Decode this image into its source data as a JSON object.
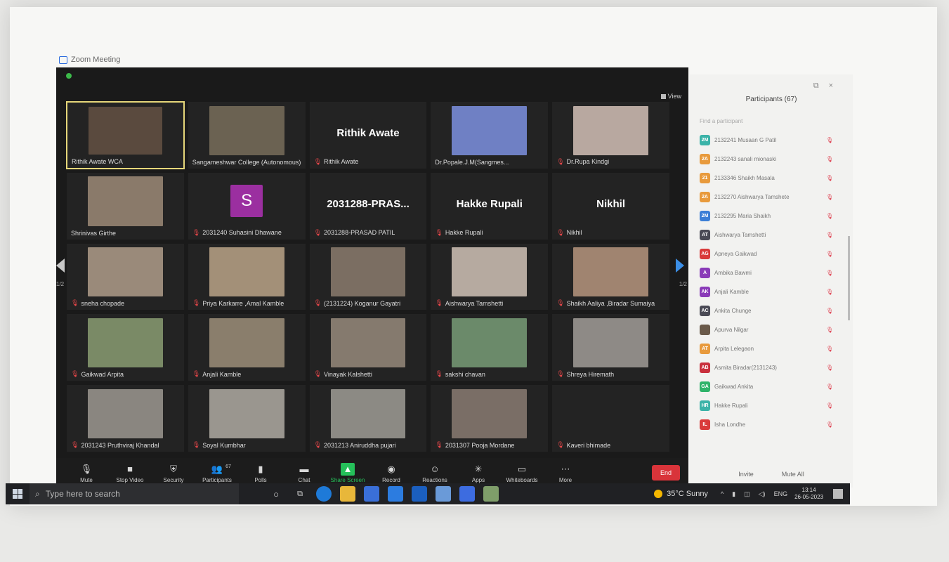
{
  "window": {
    "title": "Zoom Meeting"
  },
  "view_label": "View",
  "grid": [
    {
      "name": "Rithik Awate WCA",
      "kind": "video",
      "bg": "#5a4a3e",
      "active": true,
      "muted": false
    },
    {
      "name": "Sangameshwar College (Autonomous)",
      "kind": "video",
      "bg": "#6b6252",
      "muted": false
    },
    {
      "name": "Rithik Awate",
      "kind": "name",
      "big": "Rithik Awate",
      "muted": true
    },
    {
      "name": "Dr.Popale.J.M(Sangmes...",
      "kind": "video",
      "bg": "#6f80c4",
      "muted": false
    },
    {
      "name": "Dr.Rupa Kindgi",
      "kind": "video",
      "bg": "#b8a8a0",
      "muted": true
    },
    {
      "name": "Shrinivas Girthe",
      "kind": "video",
      "bg": "#8a7a6a",
      "muted": false
    },
    {
      "name": "2031240 Suhasini Dhawane",
      "kind": "avatar",
      "letter": "S",
      "muted": true
    },
    {
      "name": "2031288-PRASAD PATIL",
      "kind": "name",
      "big": "2031288-PRAS...",
      "muted": true
    },
    {
      "name": "Hakke Rupali",
      "kind": "name",
      "big": "Hakke Rupali",
      "muted": true
    },
    {
      "name": "Nikhil",
      "kind": "name",
      "big": "Nikhil",
      "muted": true
    },
    {
      "name": "sneha chopade",
      "kind": "video",
      "bg": "#9a8a7a",
      "muted": true
    },
    {
      "name": "Priya Karkarre ,Amal Kamble",
      "kind": "video",
      "bg": "#a39078",
      "muted": true
    },
    {
      "name": "(2131224) Koganur Gayatri",
      "kind": "video",
      "bg": "#7b6e62",
      "muted": true
    },
    {
      "name": "Aishwarya Tamshetti",
      "kind": "video",
      "bg": "#b6aaa0",
      "muted": true
    },
    {
      "name": "Shaikh Aaliya ,Biradar Sumaiya",
      "kind": "video",
      "bg": "#a08470",
      "muted": true
    },
    {
      "name": "Gaikwad Arpita",
      "kind": "video",
      "bg": "#7a8a66",
      "muted": true
    },
    {
      "name": "Anjali Kamble",
      "kind": "video",
      "bg": "#8a7e6c",
      "muted": true
    },
    {
      "name": "Vinayak Kalshetti",
      "kind": "video",
      "bg": "#857a6e",
      "muted": true
    },
    {
      "name": "sakshi chavan",
      "kind": "video",
      "bg": "#6b8a6a",
      "muted": true
    },
    {
      "name": "Shreya Hiremath",
      "kind": "video",
      "bg": "#8e8a86",
      "muted": true
    },
    {
      "name": "2031243 Pruthviraj Khandal",
      "kind": "video",
      "bg": "#8a8680",
      "muted": true
    },
    {
      "name": "Soyal Kumbhar",
      "kind": "video",
      "bg": "#9a968f",
      "muted": true
    },
    {
      "name": "2031213 Aniruddha pujari",
      "kind": "video",
      "bg": "#8c8a84",
      "muted": true
    },
    {
      "name": "2031307 Pooja Mordane",
      "kind": "video",
      "bg": "#7a6e66",
      "muted": true
    },
    {
      "name": "Kaveri bhimade",
      "kind": "empty",
      "muted": true
    }
  ],
  "pager": {
    "left": "1/2",
    "right": "1/2"
  },
  "toolbar": {
    "items": [
      {
        "label": "Mute",
        "icon": "microphone-icon",
        "glyph": "🎙"
      },
      {
        "label": "Stop Video",
        "icon": "video-camera-icon",
        "glyph": "■"
      },
      {
        "label": "Security",
        "icon": "shield-icon",
        "glyph": "⛨"
      },
      {
        "label": "Participants",
        "icon": "participants-icon",
        "glyph": "👥",
        "badge": "67"
      },
      {
        "label": "Polls",
        "icon": "polls-icon",
        "glyph": "▮"
      },
      {
        "label": "Chat",
        "icon": "chat-icon",
        "glyph": "▬"
      },
      {
        "label": "Share Screen",
        "icon": "share-screen-icon",
        "glyph": "▲"
      },
      {
        "label": "Record",
        "icon": "record-icon",
        "glyph": "◉"
      },
      {
        "label": "Reactions",
        "icon": "reactions-icon",
        "glyph": "☺"
      },
      {
        "label": "Apps",
        "icon": "apps-icon",
        "glyph": "✳"
      },
      {
        "label": "Whiteboards",
        "icon": "whiteboard-icon",
        "glyph": "▭"
      },
      {
        "label": "More",
        "icon": "more-icon",
        "glyph": "⋯"
      }
    ],
    "end_label": "End"
  },
  "participants": {
    "title": "Participants (67)",
    "find_placeholder": "Find a participant",
    "list": [
      {
        "initials": "2M",
        "name": "2132241 Musaan G Patil",
        "color": "#3bb3a8"
      },
      {
        "initials": "2A",
        "name": "2132243 sanali mionaski",
        "color": "#e89a3c"
      },
      {
        "initials": "21",
        "name": "2133346 Shaikh Masala",
        "color": "#e89a3c"
      },
      {
        "initials": "2A",
        "name": "2132270 Aishwarya Tamshete",
        "color": "#e89a3c"
      },
      {
        "initials": "2M",
        "name": "2132295 Maria Shaikh",
        "color": "#3b7ed6"
      },
      {
        "initials": "AT",
        "name": "Aishwarya Tamshetti",
        "color": "#4a4a55"
      },
      {
        "initials": "AG",
        "name": "Apneya Gaikwad",
        "color": "#d93b3b"
      },
      {
        "initials": "A",
        "name": "Ambika Bawmi",
        "color": "#8a3bb8"
      },
      {
        "initials": "AK",
        "name": "Anjali Kamble",
        "color": "#8a3bb8"
      },
      {
        "initials": "AC",
        "name": "Ankita Chunge",
        "color": "#4a4a55"
      },
      {
        "initials": "",
        "name": "Apurva Nilgar",
        "color": "#6a5a4a"
      },
      {
        "initials": "AT",
        "name": "Arpita Lelegaon",
        "color": "#e89a3c"
      },
      {
        "initials": "AB",
        "name": "Asmita Biradar(2131243)",
        "color": "#c9303d"
      },
      {
        "initials": "GA",
        "name": "Gaikwad Ankita",
        "color": "#2fb36a"
      },
      {
        "initials": "HR",
        "name": "Hakke Rupali",
        "color": "#3bb3a8"
      },
      {
        "initials": "IL",
        "name": "Isha Londhe",
        "color": "#d93b3b"
      }
    ],
    "invite_label": "Invite",
    "mute_all_label": "Mute All"
  },
  "taskbar": {
    "search_placeholder": "Type here to search",
    "weather": "35°C Sunny",
    "lang": "ENG",
    "time": "13:14",
    "date": "26-05-2023"
  }
}
